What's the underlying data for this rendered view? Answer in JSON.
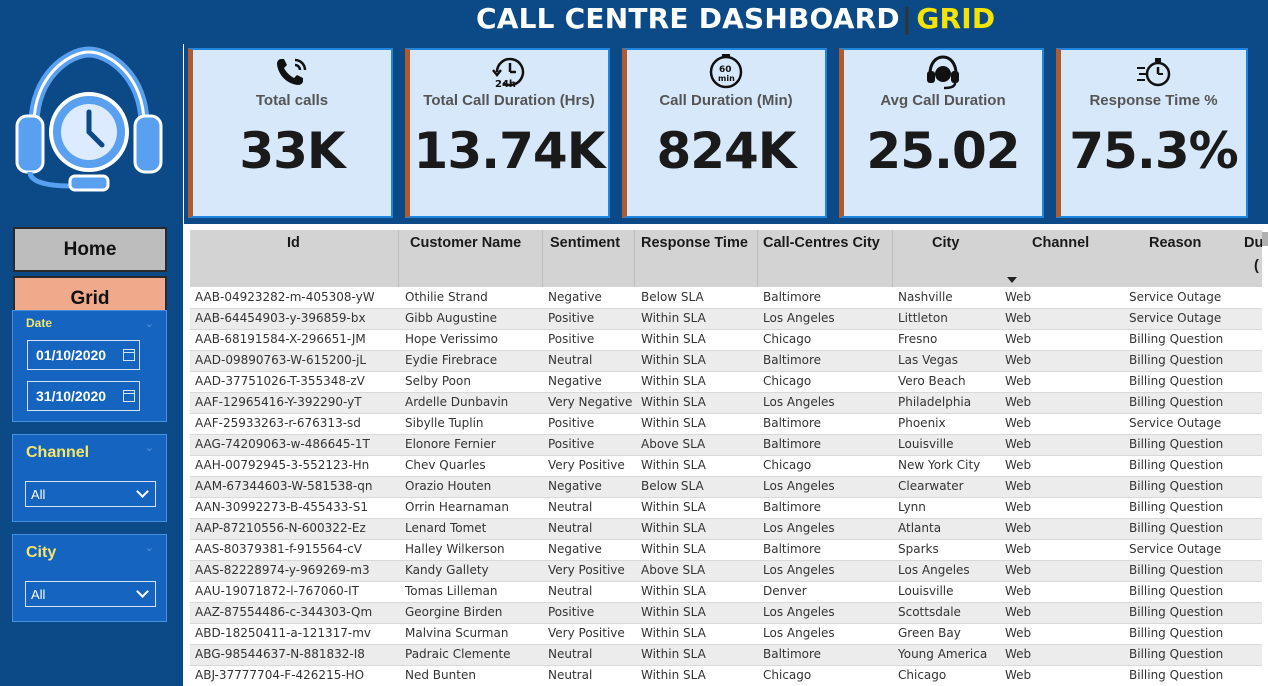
{
  "header": {
    "title": "CALL CENTRE DASHBOARD",
    "separator": "|",
    "title_accent": "GRID"
  },
  "nav": {
    "home_label": "Home",
    "grid_label": "Grid"
  },
  "filters": {
    "date": {
      "title": "Date",
      "from": "01/10/2020",
      "to": "31/10/2020"
    },
    "channel": {
      "title": "Channel",
      "selected": "All"
    },
    "city": {
      "title": "City",
      "selected": "All"
    }
  },
  "kpis": [
    {
      "label": "Total calls",
      "value": "33K",
      "icon": "phone-icon"
    },
    {
      "label": "Total Call Duration (Hrs)",
      "value": "13.74K",
      "icon": "24h-clock-icon"
    },
    {
      "label": "Call Duration (Min)",
      "value": "824K",
      "icon": "60-min-timer-icon"
    },
    {
      "label": "Avg Call Duration",
      "value": "25.02",
      "icon": "headset-icon"
    },
    {
      "label": "Response Time %",
      "value": "75.3%",
      "icon": "stopwatch-icon"
    }
  ],
  "table": {
    "columns": [
      "Id",
      "Customer Name",
      "Sentiment",
      "Response Time",
      "Call-Centres City",
      "City",
      "Channel",
      "Reason",
      "Du",
      "("
    ],
    "rows": [
      [
        "AAB-04923282-m-405308-yW",
        "Othilie Strand",
        "Negative",
        "Below SLA",
        "Baltimore",
        "Nashville",
        "Web",
        "Service Outage"
      ],
      [
        "AAB-64454903-y-396859-bx",
        "Gibb Augustine",
        "Positive",
        "Within SLA",
        "Los Angeles",
        "Littleton",
        "Web",
        "Service Outage"
      ],
      [
        "AAB-68191584-X-296651-JM",
        "Hope Verissimo",
        "Positive",
        "Within SLA",
        "Chicago",
        "Fresno",
        "Web",
        "Billing Question"
      ],
      [
        "AAD-09890763-W-615200-jL",
        "Eydie Firebrace",
        "Neutral",
        "Within SLA",
        "Baltimore",
        "Las Vegas",
        "Web",
        "Billing Question"
      ],
      [
        "AAD-37751026-T-355348-zV",
        "Selby Poon",
        "Negative",
        "Within SLA",
        "Chicago",
        "Vero Beach",
        "Web",
        "Billing Question"
      ],
      [
        "AAF-12965416-Y-392290-yT",
        "Ardelle Dunbavin",
        "Very Negative",
        "Within SLA",
        "Los Angeles",
        "Philadelphia",
        "Web",
        "Billing Question"
      ],
      [
        "AAF-25933263-r-676313-sd",
        "Sibylle Tuplin",
        "Positive",
        "Within SLA",
        "Baltimore",
        "Phoenix",
        "Web",
        "Service Outage"
      ],
      [
        "AAG-74209063-w-486645-1T",
        "Elonore Fernier",
        "Positive",
        "Above SLA",
        "Baltimore",
        "Louisville",
        "Web",
        "Billing Question"
      ],
      [
        "AAH-00792945-3-552123-Hn",
        "Chev Quarles",
        "Very Positive",
        "Within SLA",
        "Chicago",
        "New York City",
        "Web",
        "Billing Question"
      ],
      [
        "AAM-67344603-W-581538-qn",
        "Orazio Houten",
        "Negative",
        "Below SLA",
        "Los Angeles",
        "Clearwater",
        "Web",
        "Billing Question"
      ],
      [
        "AAN-30992273-B-455433-S1",
        "Orrin Hearnaman",
        "Neutral",
        "Within SLA",
        "Baltimore",
        "Lynn",
        "Web",
        "Billing Question"
      ],
      [
        "AAP-87210556-N-600322-Ez",
        "Lenard Tomet",
        "Neutral",
        "Within SLA",
        "Los Angeles",
        "Atlanta",
        "Web",
        "Billing Question"
      ],
      [
        "AAS-80379381-f-915564-cV",
        "Halley Wilkerson",
        "Negative",
        "Within SLA",
        "Baltimore",
        "Sparks",
        "Web",
        "Service Outage"
      ],
      [
        "AAS-82228974-y-969269-m3",
        "Kandy Gallety",
        "Very Positive",
        "Above SLA",
        "Los Angeles",
        "Los Angeles",
        "Web",
        "Billing Question"
      ],
      [
        "AAU-19071872-l-767060-IT",
        "Tomas Lilleman",
        "Neutral",
        "Within SLA",
        "Denver",
        "Louisville",
        "Web",
        "Billing Question"
      ],
      [
        "AAZ-87554486-c-344303-Qm",
        "Georgine Birden",
        "Positive",
        "Within SLA",
        "Los Angeles",
        "Scottsdale",
        "Web",
        "Billing Question"
      ],
      [
        "ABD-18250411-a-121317-mv",
        "Malvina Scurman",
        "Very Positive",
        "Within SLA",
        "Los Angeles",
        "Green Bay",
        "Web",
        "Billing Question"
      ],
      [
        "ABG-98544637-N-881832-I8",
        "Padraic Clemente",
        "Neutral",
        "Within SLA",
        "Baltimore",
        "Young America",
        "Web",
        "Billing Question"
      ],
      [
        "ABJ-37777704-F-426215-HO",
        "Ned Bunten",
        "Neutral",
        "Within SLA",
        "Chicago",
        "Chicago",
        "Web",
        "Billing Question"
      ]
    ]
  },
  "colors": {
    "header_bg": "#0b4a86",
    "accent": "#f5e400",
    "kpi_bg": "#d8e8fb",
    "kpi_border": "#1f86e0",
    "slicer_bg": "#1565c0"
  }
}
